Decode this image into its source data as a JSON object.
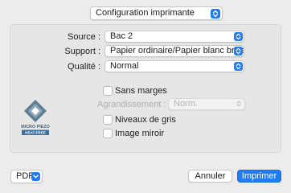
{
  "header": {
    "preset_value": "Configuration imprimante"
  },
  "settings": {
    "source": {
      "label": "Source :",
      "value": "Bac 2"
    },
    "support": {
      "label": "Support :",
      "value": "Papier ordinaire/Papier blanc brillant"
    },
    "qualite": {
      "label": "Qualité :",
      "value": "Normal"
    }
  },
  "options": {
    "sans_marges": "Sans marges",
    "agrandissement_label": "Agrandissement :",
    "agrandissement_value": "Norm.",
    "niveaux_de_gris": "Niveaux de gris",
    "image_miroir": "Image miroir"
  },
  "logo": {
    "line1": "MICRO PIEZO",
    "line2": "HEAT-FREE"
  },
  "footer": {
    "pdf_label": "PDF",
    "cancel_label": "Annuler",
    "print_label": "Imprimer"
  },
  "colors": {
    "accent": "#1f7cf5"
  }
}
